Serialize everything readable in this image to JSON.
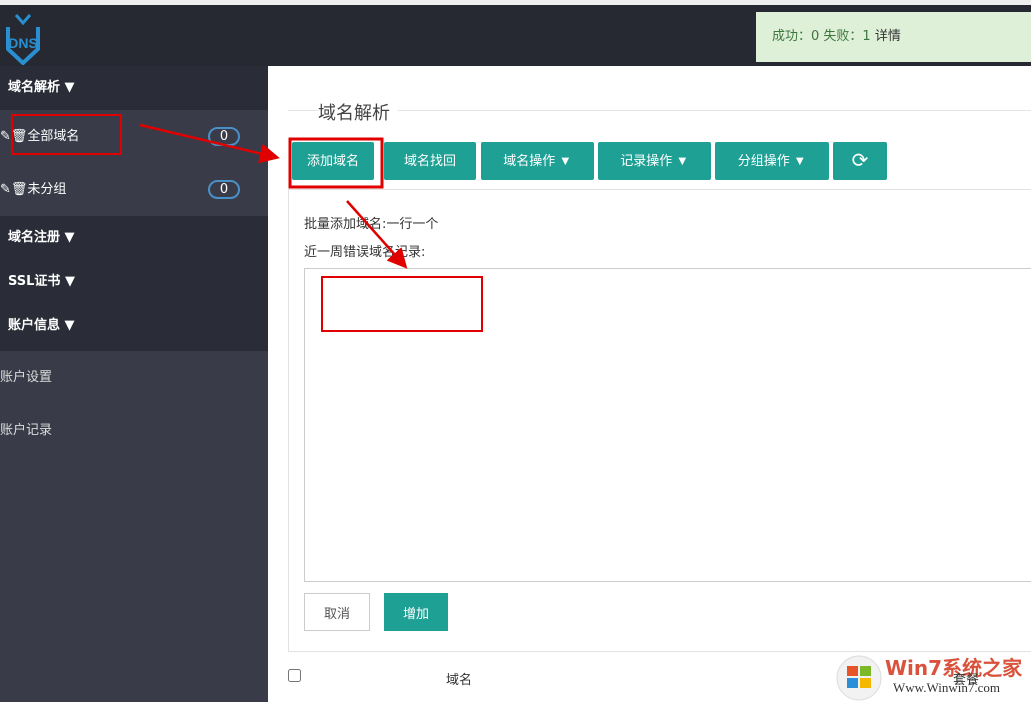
{
  "header": {
    "logo_text": "DNS",
    "alert": {
      "text": "成功：0 失败：1 ",
      "detail": "详情"
    }
  },
  "sidebar": {
    "sections": [
      {
        "label": "域名解析 ▼",
        "items": [
          {
            "label": "全部域名",
            "count": "0"
          },
          {
            "label": "未分组",
            "count": "0"
          }
        ]
      },
      {
        "label": "域名注册 ▼"
      },
      {
        "label": "SSL证书 ▼"
      },
      {
        "label": "账户信息 ▼",
        "items": [
          {
            "label": "账户设置"
          },
          {
            "label": "账户记录"
          }
        ]
      }
    ]
  },
  "main": {
    "title": "域名解析",
    "toolbar": [
      "添加域名",
      "域名找回",
      "域名操作 ▼",
      "记录操作 ▼",
      "分组操作 ▼"
    ],
    "refresh_icon": "⟳",
    "form": {
      "label1": "批量添加域名:一行一个",
      "label2": "近一周错误域名记录:",
      "textarea": "",
      "cancel": "取消",
      "add": "增加"
    },
    "table": {
      "columns": [
        "域名",
        "套餐"
      ]
    }
  },
  "watermark": {
    "brand": "Win7系统之家",
    "url": "Www.Winwin7.com"
  },
  "annotation_color": "#e00000"
}
